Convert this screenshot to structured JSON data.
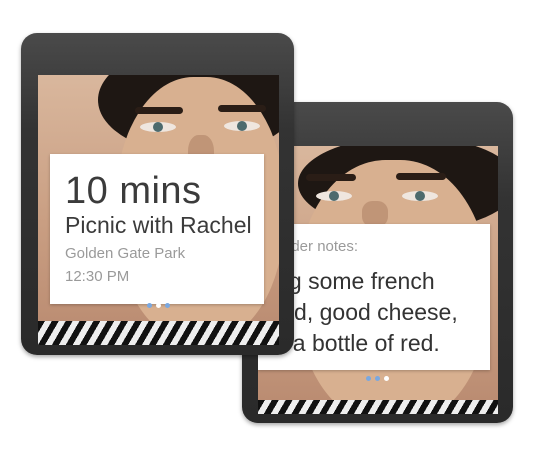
{
  "front_card": {
    "time": "10 mins",
    "title": "Picnic with Rachel",
    "location": "Golden Gate Park",
    "start": "12:30 PM"
  },
  "back_card": {
    "label": "Reminder notes:",
    "line1": "Bring some french",
    "line2": "bread, good cheese,",
    "line3": "and a bottle of red."
  },
  "pagination": {
    "front_active_index": 1,
    "back_active_index": 2,
    "count": 3
  },
  "colors": {
    "dot_active": "#ffffff",
    "dot_inactive": "#7aa8e0"
  }
}
